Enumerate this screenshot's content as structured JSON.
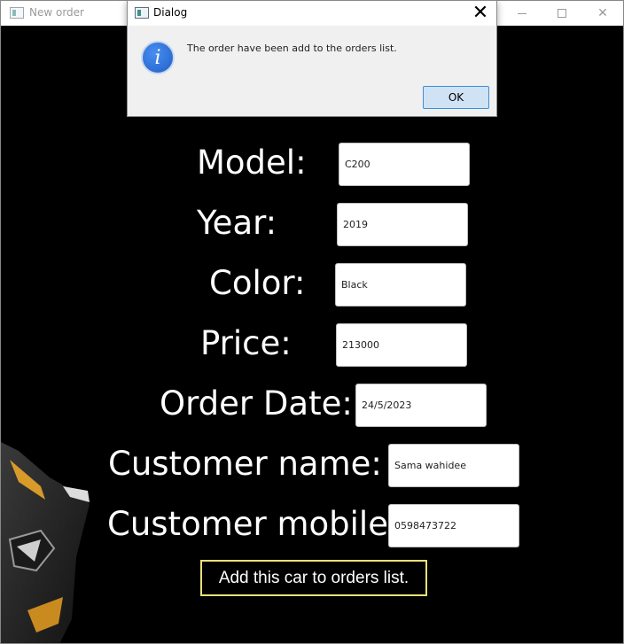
{
  "main_window": {
    "title": "New order"
  },
  "form": {
    "model_label": "Model:",
    "model_value": "C200",
    "year_label": "Year:",
    "year_value": "2019",
    "color_label": "Color:",
    "color_value": "Black",
    "price_label": "Price:",
    "price_value": "213000",
    "order_date_label": "Order Date:",
    "order_date_value": "24/5/2023",
    "customer_name_label": "Customer name:",
    "customer_name_value": "Sama wahidee",
    "customer_mobile_label": "Customer mobile:",
    "customer_mobile_value": "0598473722",
    "add_button_label": "Add this car to orders list."
  },
  "dialog": {
    "title": "Dialog",
    "message": "The order have been add to the orders list.",
    "ok_label": "OK",
    "info_icon": "information-icon"
  },
  "colors": {
    "background": "#000000",
    "button_border": "#e9e07a",
    "ok_button_bg": "#cfe3f5",
    "ok_button_border": "#3c8fd6"
  }
}
